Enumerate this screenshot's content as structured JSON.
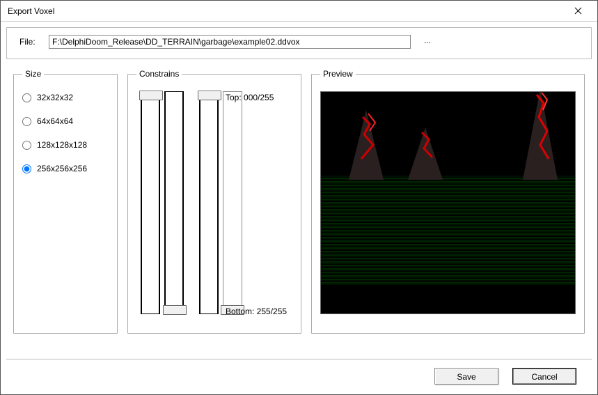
{
  "window": {
    "title": "Export Voxel"
  },
  "file": {
    "label": "File:",
    "value": "F:\\DelphiDoom_Release\\DD_TERRAIN\\garbage\\example02.ddvox",
    "browse_label": "..."
  },
  "size": {
    "legend": "Size",
    "options": [
      {
        "label": "32x32x32",
        "checked": false
      },
      {
        "label": "64x64x64",
        "checked": false
      },
      {
        "label": "128x128x128",
        "checked": false
      },
      {
        "label": "256x256x256",
        "checked": true
      }
    ]
  },
  "constrains": {
    "legend": "Constrains",
    "top_label": "Top: 000/255",
    "bottom_label": "Bottom: 255/255"
  },
  "preview": {
    "legend": "Preview"
  },
  "buttons": {
    "save": "Save",
    "cancel": "Cancel"
  }
}
